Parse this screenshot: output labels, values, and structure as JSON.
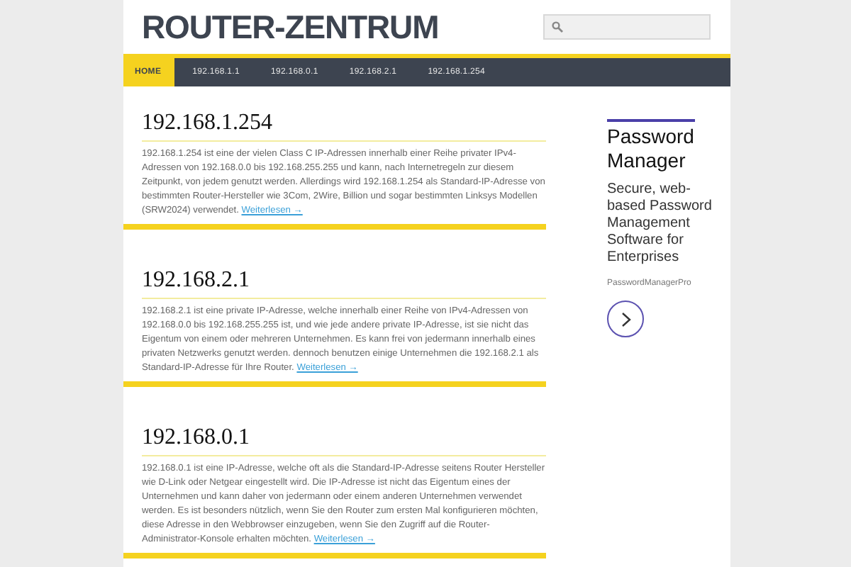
{
  "header": {
    "site_title": "ROUTER-ZENTRUM"
  },
  "nav": [
    {
      "label": "HOME",
      "selected": true
    },
    {
      "label": "192.168.1.1",
      "selected": false
    },
    {
      "label": "192.168.0.1",
      "selected": false
    },
    {
      "label": "192.168.2.1",
      "selected": false
    },
    {
      "label": "192.168.1.254",
      "selected": false
    }
  ],
  "posts": [
    {
      "title": "192.168.1.254",
      "excerpt": "192.168.1.254 ist eine der vielen Class C IP-Adressen innerhalb einer Reihe privater IPv4-Adressen von 192.168.0.0 bis 192.168.255.255 und kann, nach Internetregeln zur diesem Zeitpunkt, von jedem genutzt werden. Allerdings wird 192.168.1.254 als Standard-IP-Adresse von bestimmten Router-Hersteller wie 3Com, 2Wire, Billion und sogar bestimmten Linksys Modellen (SRW2024) verwendet.",
      "more": "Weiterlesen →"
    },
    {
      "title": "192.168.2.1",
      "excerpt": "192.168.2.1 ist eine private IP-Adresse, welche innerhalb einer Reihe von IPv4-Adressen von 192.168.0.0 bis 192.168.255.255 ist, und wie jede andere private IP-Adresse, ist sie nicht das Eigentum von einem oder mehreren Unternehmen. Es kann frei von jedermann innerhalb eines privaten Netzwerks genutzt werden. dennoch benutzen einige Unternehmen die 192.168.2.1 als Standard-IP-Adresse für Ihre Router.",
      "more": "Weiterlesen →"
    },
    {
      "title": "192.168.0.1",
      "excerpt": "192.168.0.1 ist eine IP-Adresse, welche oft als die Standard-IP-Adresse seitens Router Hersteller wie D-Link oder Netgear eingestellt wird. Die IP-Adresse ist nicht das Eigentum eines der Unternehmen und kann daher von jedermann oder einem anderen Unternehmen verwendet werden. Es ist besonders nützlich, wenn Sie den Router zum ersten Mal konfigurieren möchten, diese Adresse in den Webbrowser einzugeben, wenn Sie den Zugriff auf die Router-Administrator-Konsole erhalten möchten.",
      "more": "Weiterlesen →"
    }
  ],
  "ad": {
    "headline": "Password Manager",
    "body": "Secure, web-based Password Management Software for Enterprises",
    "advertiser": "PasswordManagerPro"
  }
}
